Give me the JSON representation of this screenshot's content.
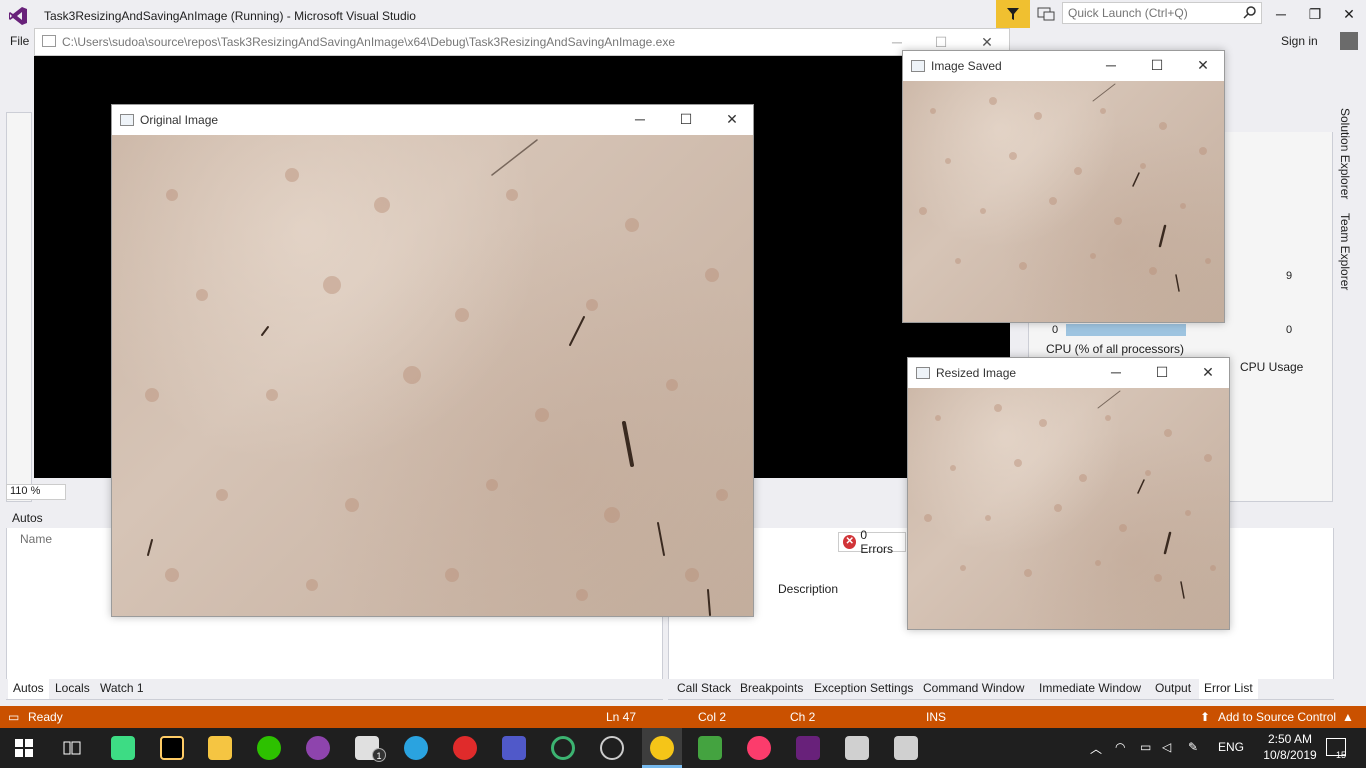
{
  "vs": {
    "title": "Task3ResizingAndSavingAnImage (Running) - Microsoft Visual Studio",
    "quick_launch_placeholder": "Quick Launch (Ctrl+Q)",
    "sign_in": "Sign in",
    "menu_file": "File",
    "zoom": "110 %",
    "vertical_tabs": [
      "Solution Explorer",
      "Team Explorer"
    ]
  },
  "console": {
    "path": "C:\\Users\\sudoa\\source\\repos\\Task3ResizingAndSavingAnImage\\x64\\Debug\\Task3ResizingAndSavingAnImage.exe"
  },
  "windows": {
    "original": "Original Image",
    "saved": "Image Saved",
    "resized": "Resized Image"
  },
  "autos": {
    "title": "Autos",
    "name_col": "Name",
    "tabs": [
      "Autos",
      "Locals",
      "Watch 1"
    ]
  },
  "errorlist": {
    "errors": "0 Errors",
    "description_col": "Description",
    "tabs": [
      "Call Stack",
      "Breakpoints",
      "Exception Settings",
      "Command Window",
      "Immediate Window",
      "Output",
      "Error List"
    ]
  },
  "diagnostics": {
    "cpu_label": "CPU (% of all processors)",
    "cpu_usage_tab": "CPU Usage",
    "graph_max": "9",
    "graph_min": "0",
    "graph_min_left": "0"
  },
  "status": {
    "ready": "Ready",
    "ln": "Ln 47",
    "col": "Col 2",
    "ch": "Ch 2",
    "ins": "INS",
    "source_control": "Add to Source Control"
  },
  "tray": {
    "lang": "ENG",
    "time": "2:50 AM",
    "date": "10/8/2019",
    "notifications": "15"
  },
  "colors": {
    "status_bar": "#ca5100",
    "accent": "#68217a",
    "filter": "#f0c030"
  }
}
